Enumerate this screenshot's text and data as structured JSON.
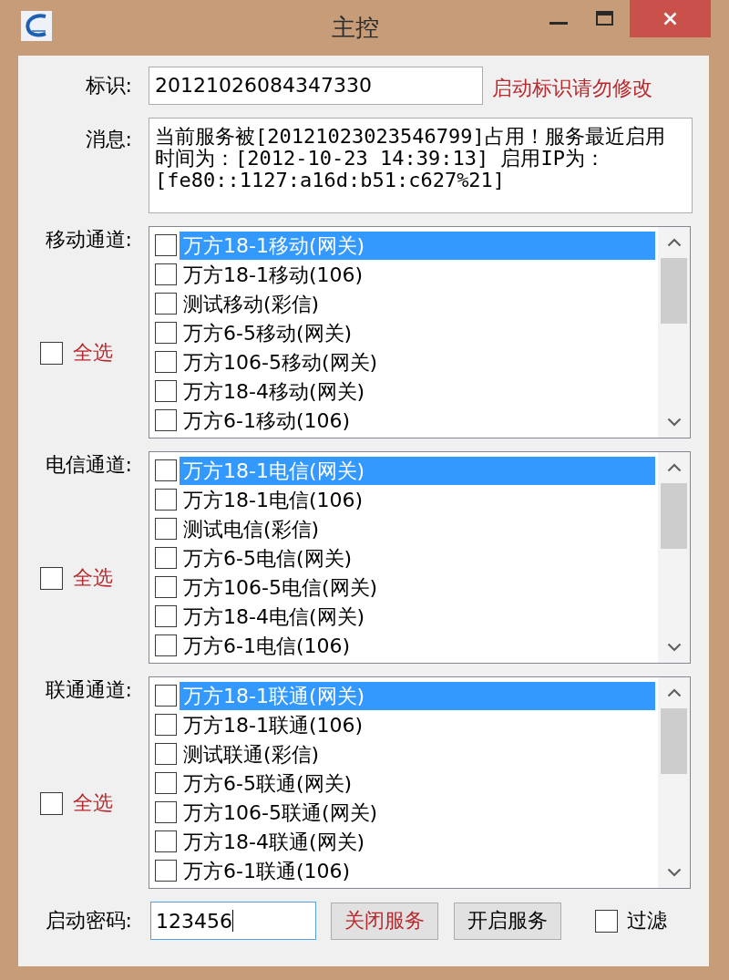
{
  "window": {
    "title": "主控"
  },
  "id_row": {
    "label": "标识:",
    "value": "20121026084347330",
    "note": "启动标识请勿修改"
  },
  "message_row": {
    "label": "消息:",
    "value": "当前服务被[20121023023546799]占用！服务最近启用时间为：[2012-10-23 14:39:13] 启用IP为：[fe80::1127:a16d:b51:c627%21]"
  },
  "channel_groups": [
    {
      "label": "移动通道:",
      "select_all": {
        "label": "全选",
        "checked": false
      },
      "items": [
        {
          "label": "万方18-1移动(网关)",
          "checked": false,
          "selected": true
        },
        {
          "label": "万方18-1移动(106)",
          "checked": false,
          "selected": false
        },
        {
          "label": "测试移动(彩信)",
          "checked": false,
          "selected": false
        },
        {
          "label": "万方6-5移动(网关)",
          "checked": false,
          "selected": false
        },
        {
          "label": "万方106-5移动(网关)",
          "checked": false,
          "selected": false
        },
        {
          "label": "万方18-4移动(网关)",
          "checked": false,
          "selected": false
        },
        {
          "label": "万方6-1移动(106)",
          "checked": false,
          "selected": false
        }
      ]
    },
    {
      "label": "电信通道:",
      "select_all": {
        "label": "全选",
        "checked": false
      },
      "items": [
        {
          "label": "万方18-1电信(网关)",
          "checked": false,
          "selected": true
        },
        {
          "label": "万方18-1电信(106)",
          "checked": false,
          "selected": false
        },
        {
          "label": "测试电信(彩信)",
          "checked": false,
          "selected": false
        },
        {
          "label": "万方6-5电信(网关)",
          "checked": false,
          "selected": false
        },
        {
          "label": "万方106-5电信(网关)",
          "checked": false,
          "selected": false
        },
        {
          "label": "万方18-4电信(网关)",
          "checked": false,
          "selected": false
        },
        {
          "label": "万方6-1电信(106)",
          "checked": false,
          "selected": false
        }
      ]
    },
    {
      "label": "联通通道:",
      "select_all": {
        "label": "全选",
        "checked": false
      },
      "items": [
        {
          "label": "万方18-1联通(网关)",
          "checked": false,
          "selected": true
        },
        {
          "label": "万方18-1联通(106)",
          "checked": false,
          "selected": false
        },
        {
          "label": "测试联通(彩信)",
          "checked": false,
          "selected": false
        },
        {
          "label": "万方6-5联通(网关)",
          "checked": false,
          "selected": false
        },
        {
          "label": "万方106-5联通(网关)",
          "checked": false,
          "selected": false
        },
        {
          "label": "万方18-4联通(网关)",
          "checked": false,
          "selected": false
        },
        {
          "label": "万方6-1联通(106)",
          "checked": false,
          "selected": false
        }
      ]
    }
  ],
  "password_row": {
    "label": "启动密码:",
    "value": "123456",
    "focused": true
  },
  "buttons": [
    {
      "label": "关闭服务",
      "kind": "danger"
    },
    {
      "label": "开启服务",
      "kind": "default"
    }
  ],
  "filter": {
    "label": "过滤",
    "checked": false
  }
}
